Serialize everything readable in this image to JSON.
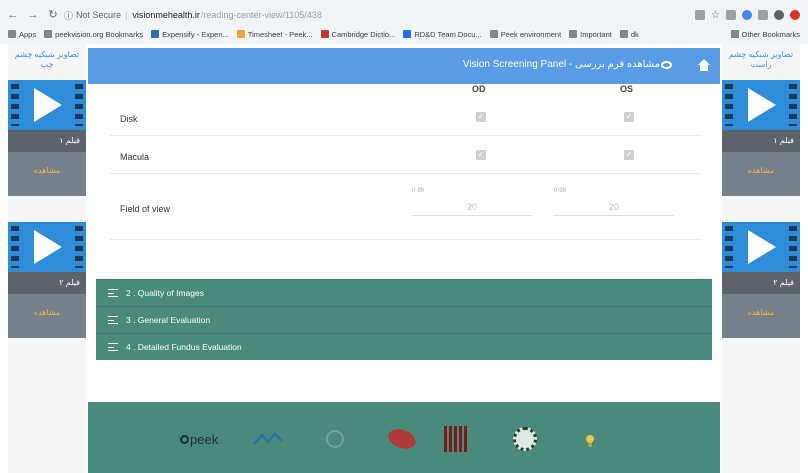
{
  "browser": {
    "security": "Not Secure",
    "host": "visionmehealth.ir",
    "path": "/reading-center-view/1105/438",
    "bookmarks": [
      "Apps",
      "peekvision.org Bookmarks",
      "Expensify - Expen...",
      "Timesheet - Peek...",
      "Cambridge Dictio...",
      "RD&D Team Docu...",
      "Peek environment",
      "Important",
      "dk"
    ],
    "other_bookmarks": "Other Bookmarks"
  },
  "left_panel": {
    "title": "تصاویر شبکیه چشم چپ",
    "videos": [
      {
        "name": "فیلم ۱",
        "view": "مشاهده"
      },
      {
        "name": "فیلم ۲",
        "view": "مشاهده"
      }
    ]
  },
  "right_panel": {
    "title": "تصاویر شبکیه چشم راست",
    "videos": [
      {
        "name": "فیلم ۱",
        "view": "مشاهده"
      },
      {
        "name": "فیلم ۲",
        "view": "مشاهده"
      }
    ]
  },
  "header": {
    "title": "Vision Screening Panel - مشاهده فرم بررسی"
  },
  "form": {
    "col_od": "OD",
    "col_os": "OS",
    "rows": [
      {
        "label": "Disk",
        "od_checked": true,
        "os_checked": true
      },
      {
        "label": "Macula",
        "od_checked": true,
        "os_checked": true
      }
    ],
    "fov": {
      "label": "Field of view",
      "od_caption": "0-99",
      "od_value": "20",
      "os_caption": "0-99",
      "os_value": "20"
    }
  },
  "sections": [
    {
      "label": "2 . Quality of Images"
    },
    {
      "label": "3 . General Evaluation"
    },
    {
      "label": "4 . Detailed Fundus Evaluation"
    }
  ],
  "footer": {
    "peek_logo": "peek"
  },
  "colors": {
    "header_blue": "#5a9be6",
    "accent_green": "#4a8a7a",
    "video_blue": "#2f8cd9",
    "view_link": "#f2b441"
  }
}
